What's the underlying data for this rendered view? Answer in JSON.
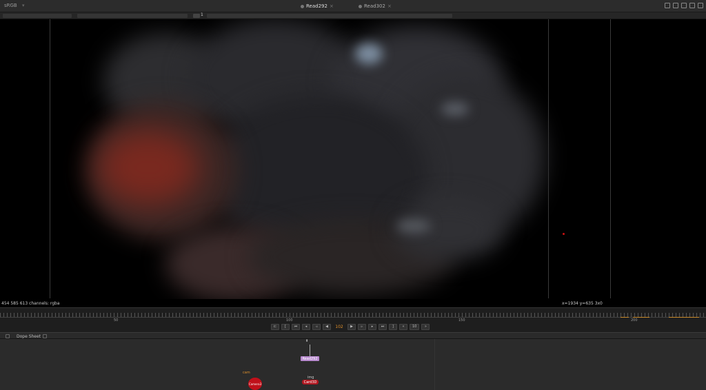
{
  "topbar": {
    "channel_label": "sRGB",
    "tabs": [
      {
        "label": "Read292",
        "active": true
      },
      {
        "label": "Read302",
        "active": false
      }
    ],
    "frame_field": "1"
  },
  "viewer": {
    "status_left": "454 585 613 channels: rgba",
    "status_right": "x=1934 y=635 3x0"
  },
  "timeline": {
    "ticks": [
      "50",
      "100",
      "150",
      "200"
    ],
    "current_frame": "102",
    "increment": "10",
    "colors": {
      "accent": "#e0902a",
      "keyframe": "#c88a2a"
    }
  },
  "panel": {
    "tab_label": "Dope Sheet"
  },
  "node_graph": {
    "nodes": [
      {
        "label": "Read292",
        "color": "#b98bd0"
      },
      {
        "label": "Card3D",
        "color": "#b0161f"
      },
      {
        "label": "Camera3",
        "color": "#c0101a"
      }
    ],
    "small_labels": [
      "img",
      "cam"
    ]
  }
}
